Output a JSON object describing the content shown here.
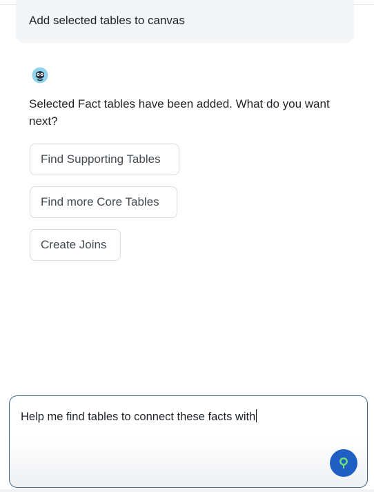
{
  "user_message": {
    "text": "Add selected tables to canvas"
  },
  "assistant": {
    "avatar_icon": "robot-assistant-icon",
    "message": "Selected Fact tables have been added. What do you want next?",
    "suggestions": [
      {
        "label": "Find Supporting Tables"
      },
      {
        "label": "Find more Core Tables"
      },
      {
        "label": "Create Joins"
      }
    ]
  },
  "composer": {
    "value": "Help me find tables to connect these facts with",
    "send_icon": "send-pin-icon",
    "accent_color": "#1f5fc4",
    "border_color": "#3d6a94"
  }
}
